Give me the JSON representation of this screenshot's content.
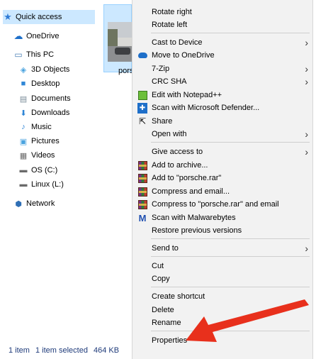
{
  "sidebar": {
    "items": [
      {
        "label": "Quick access",
        "icon": "star-icon",
        "color": "#2f7bd6",
        "glyph": "★"
      },
      {
        "label": "OneDrive",
        "icon": "cloud-icon",
        "color": "#1e6fc9",
        "glyph": "☁"
      },
      {
        "label": "This PC",
        "icon": "computer-icon",
        "color": "#4a7fb5",
        "glyph": "▭"
      },
      {
        "label": "3D Objects",
        "icon": "cube-icon",
        "color": "#4aa3df",
        "glyph": "◈"
      },
      {
        "label": "Desktop",
        "icon": "desktop-icon",
        "color": "#2f86d6",
        "glyph": "■"
      },
      {
        "label": "Documents",
        "icon": "document-icon",
        "color": "#7a8b99",
        "glyph": "▤"
      },
      {
        "label": "Downloads",
        "icon": "download-icon",
        "color": "#2f86d6",
        "glyph": "⬇"
      },
      {
        "label": "Music",
        "icon": "music-icon",
        "color": "#2f86d6",
        "glyph": "♪"
      },
      {
        "label": "Pictures",
        "icon": "picture-icon",
        "color": "#4aa3df",
        "glyph": "▣"
      },
      {
        "label": "Videos",
        "icon": "video-icon",
        "color": "#6a6a6a",
        "glyph": "▦"
      },
      {
        "label": "OS (C:)",
        "icon": "drive-icon",
        "color": "#6a6a6a",
        "glyph": "▬"
      },
      {
        "label": "Linux (L:)",
        "icon": "drive-icon",
        "color": "#6a6a6a",
        "glyph": "▬"
      },
      {
        "label": "Network",
        "icon": "network-icon",
        "color": "#2f6fb5",
        "glyph": "⬢"
      }
    ]
  },
  "file": {
    "name": "porsc"
  },
  "status": {
    "count": "1 item",
    "selection": "1 item selected",
    "size": "464 KB"
  },
  "menu": {
    "items": [
      {
        "label": "Rotate right"
      },
      {
        "label": "Rotate left"
      },
      {
        "label": "Cast to Device",
        "submenu": true
      },
      {
        "label": "Move to OneDrive",
        "icon": "onedrive-icon"
      },
      {
        "label": "7-Zip",
        "submenu": true
      },
      {
        "label": "CRC SHA",
        "submenu": true
      },
      {
        "label": "Edit with Notepad++",
        "icon": "notepad-plus-plus-icon"
      },
      {
        "label": "Scan with Microsoft Defender...",
        "icon": "defender-icon"
      },
      {
        "label": "Share",
        "icon": "share-icon"
      },
      {
        "label": "Open with",
        "submenu": true
      },
      {
        "label": "Give access to",
        "submenu": true
      },
      {
        "label": "Add to archive...",
        "icon": "winrar-icon"
      },
      {
        "label": "Add to \"porsche.rar\"",
        "icon": "winrar-icon"
      },
      {
        "label": "Compress and email...",
        "icon": "winrar-icon"
      },
      {
        "label": "Compress to \"porsche.rar\" and email",
        "icon": "winrar-icon"
      },
      {
        "label": "Scan with Malwarebytes",
        "icon": "malwarebytes-icon"
      },
      {
        "label": "Restore previous versions"
      },
      {
        "label": "Send to",
        "submenu": true
      },
      {
        "label": "Cut"
      },
      {
        "label": "Copy"
      },
      {
        "label": "Create shortcut"
      },
      {
        "label": "Delete"
      },
      {
        "label": "Rename"
      },
      {
        "label": "Properties"
      }
    ]
  },
  "annotation": {
    "arrow_color": "#e8301c"
  }
}
